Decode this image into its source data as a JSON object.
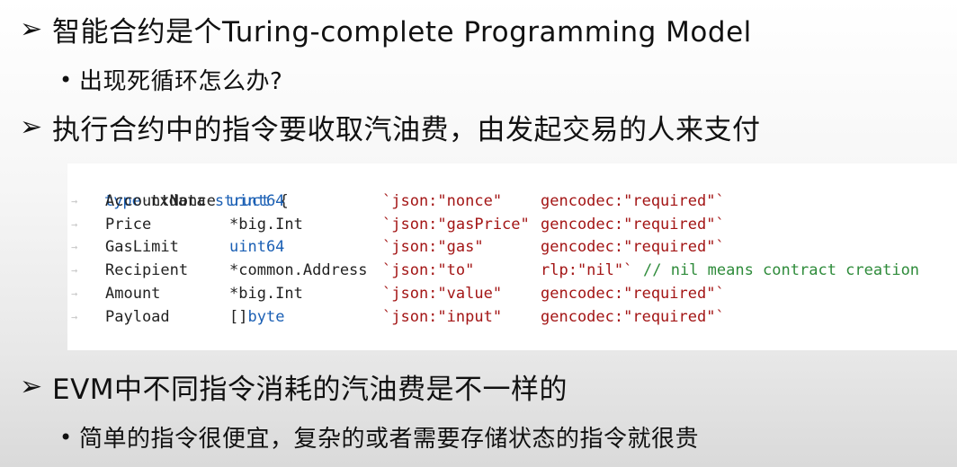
{
  "bullets": [
    {
      "marker": "➢",
      "text": "智能合约是个Turing-complete Programming Model"
    },
    {
      "marker": "•",
      "text": "出现死循环怎么办?"
    },
    {
      "marker": "➢",
      "text": "执行合约中的指令要收取汽油费，由发起交易的人来支付"
    },
    {
      "marker": "➢",
      "text": "EVM中不同指令消耗的汽油费是不一样的"
    },
    {
      "marker": "•",
      "text": "简单的指令很便宜，复杂的或者需要存储状态的指令就很贵"
    }
  ],
  "code": {
    "header": {
      "kw1": "type",
      "name": "txdata",
      "kw2": "struct",
      "brace": "{"
    },
    "fields": [
      {
        "name": "AccountNonce",
        "type": "uint64",
        "type_is_keyword": true,
        "json": "`json:\"nonce\"",
        "extra": "gencodec:\"required\"`",
        "comment": ""
      },
      {
        "name": "Price",
        "type": "*big.Int",
        "type_is_keyword": false,
        "json": "`json:\"gasPrice\"",
        "extra": "gencodec:\"required\"`",
        "comment": ""
      },
      {
        "name": "GasLimit",
        "type": "uint64",
        "type_is_keyword": true,
        "json": "`json:\"gas\"",
        "extra": "gencodec:\"required\"`",
        "comment": ""
      },
      {
        "name": "Recipient",
        "type": "*common.Address",
        "type_is_keyword": false,
        "json": "`json:\"to\"",
        "extra": "rlp:\"nil\"`",
        "comment": "// nil means contract creation"
      },
      {
        "name": "Amount",
        "type": "*big.Int",
        "type_is_keyword": false,
        "json": "`json:\"value\"",
        "extra": "gencodec:\"required\"`",
        "comment": ""
      },
      {
        "name": "Payload",
        "type_prefix": "[]",
        "type": "byte",
        "type_is_keyword": true,
        "json": "`json:\"input\"",
        "extra": "gencodec:\"required\"`",
        "comment": ""
      }
    ]
  },
  "colors": {
    "keyword": "#1a5fb4",
    "string": "#a31515",
    "comment": "#2e8b3a",
    "whitespace_marker": "#c8c8c8"
  }
}
